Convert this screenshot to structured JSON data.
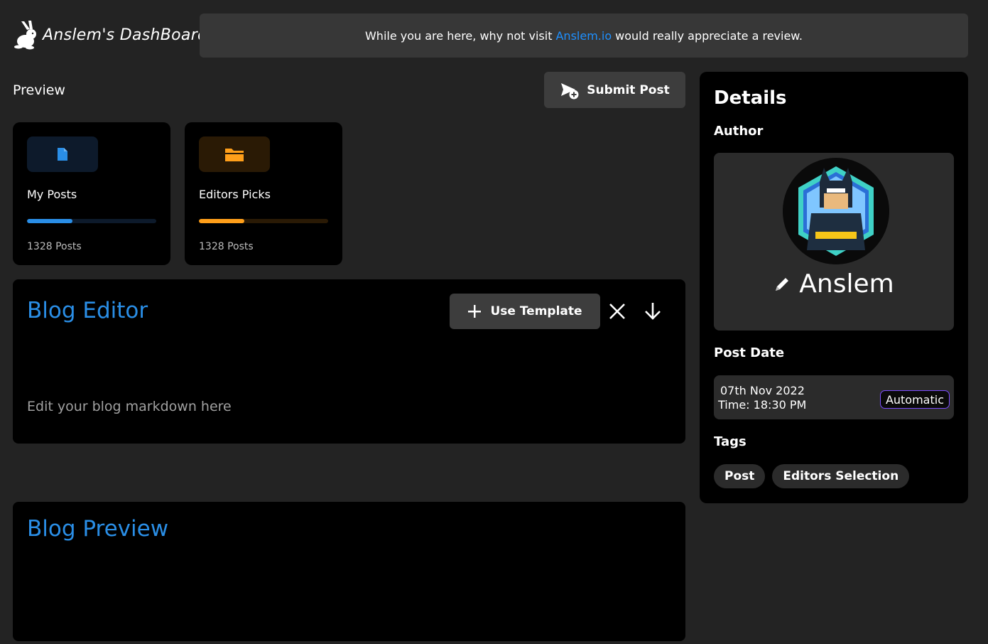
{
  "brand": {
    "title": "Anslem's DashBoard",
    "logo": "rabbit-logo"
  },
  "banner": {
    "prefix": "While you are here, why not visit",
    "link_text": "Anslem.io",
    "suffix": "would really appreciate a review."
  },
  "preview": {
    "label": "Preview"
  },
  "submit": {
    "label": "Submit Post",
    "icon": "send-plus-icon"
  },
  "cards": [
    {
      "title": "My Posts",
      "count": "1328 Posts",
      "icon": "file-icon",
      "color": "#2a8ee6",
      "progress": 0.35
    },
    {
      "title": "Editors Picks",
      "count": "1328 Posts",
      "icon": "folder-icon",
      "color": "#ff9f1a",
      "progress": 0.35
    }
  ],
  "editor": {
    "title": "Blog Editor",
    "use_template_label": "Use Template",
    "placeholder": "Edit your blog markdown here"
  },
  "blog_preview": {
    "title": "Blog Preview"
  },
  "details": {
    "title": "Details",
    "author_heading": "Author",
    "author_name": "Anslem",
    "post_date_heading": "Post Date",
    "date": "07th Nov 2022",
    "time": "Time: 18:30 PM",
    "date_mode": "Automatic",
    "tags_heading": "Tags",
    "tags": [
      "Post",
      "Editors Selection"
    ]
  },
  "colors": {
    "accent": "#2a8ee6",
    "orange": "#ff9f1a",
    "purple": "#7c4dff"
  }
}
